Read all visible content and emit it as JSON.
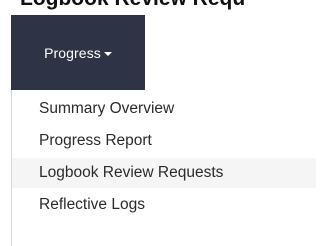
{
  "page": {
    "heading": "Logbook Review Requ"
  },
  "nav": {
    "toggle_label": "Progress",
    "toggle_background": "#2e3446",
    "caret_icon": "caret-down-icon"
  },
  "dropdown": {
    "items": [
      {
        "label": "Summary Overview",
        "active": false
      },
      {
        "label": "Progress Report",
        "active": false
      },
      {
        "label": "Logbook Review Requests",
        "active": true
      },
      {
        "label": "Reflective Logs",
        "active": false
      }
    ],
    "active_background": "#f5f5f5"
  }
}
